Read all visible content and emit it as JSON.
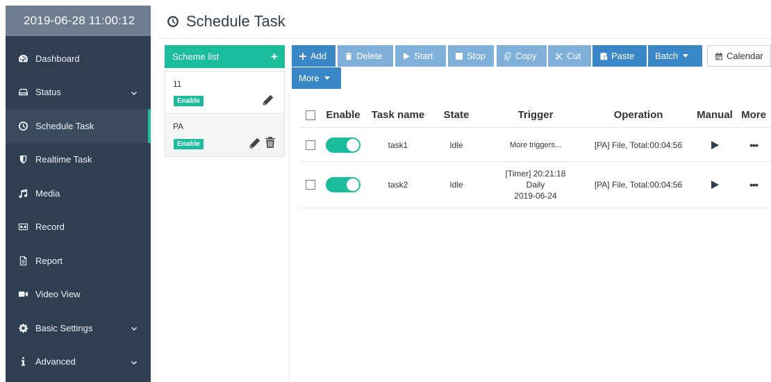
{
  "sidebar": {
    "datetime": "2019-06-28 11:00:12",
    "items": [
      {
        "label": "Dashboard",
        "icon": "dashboard-icon"
      },
      {
        "label": "Status",
        "icon": "hdd-icon",
        "expandable": true
      },
      {
        "label": "Schedule Task",
        "icon": "clock-icon",
        "active": true
      },
      {
        "label": "Realtime Task",
        "icon": "shield-icon"
      },
      {
        "label": "Media",
        "icon": "music-icon"
      },
      {
        "label": "Record",
        "icon": "voicemail-icon"
      },
      {
        "label": "Report",
        "icon": "file-icon"
      },
      {
        "label": "Video View",
        "icon": "video-icon"
      },
      {
        "label": "Basic Settings",
        "icon": "gear-icon",
        "expandable": true
      },
      {
        "label": "Advanced",
        "icon": "info-icon",
        "expandable": true
      }
    ]
  },
  "header": {
    "title": "Schedule Task"
  },
  "schemes": {
    "header_label": "Scheme list",
    "add_symbol": "+",
    "items": [
      {
        "name": "11",
        "status": "Enable"
      },
      {
        "name": "PA",
        "status": "Enable"
      }
    ]
  },
  "toolbar": {
    "add": "Add",
    "delete": "Delete",
    "start": "Start",
    "stop": "Stop",
    "copy": "Copy",
    "cut": "Cut",
    "paste": "Paste",
    "batch": "Batch",
    "calendar": "Calendar",
    "more": "More"
  },
  "table": {
    "headers": [
      "Enable",
      "Task name",
      "State",
      "Trigger",
      "Operation",
      "Manual",
      "More"
    ],
    "rows": [
      {
        "name": "task1",
        "state": "Idle",
        "trigger": [
          "More triggers..."
        ],
        "operation": "[PA] File, Total:00:04:56",
        "enabled": true,
        "more": "•••"
      },
      {
        "name": "task2",
        "state": "Idle",
        "trigger": [
          "[Timer] 20:21:18",
          "Daily",
          "2019-06-24"
        ],
        "operation": "[PA] File, Total:00:04:56",
        "enabled": true,
        "more": "•••"
      }
    ]
  },
  "colors": {
    "sidebar_bg": "#2f3e50",
    "accent": "#1abc9c",
    "primary": "#3a87c8",
    "muted_button": "#7fb0da"
  }
}
